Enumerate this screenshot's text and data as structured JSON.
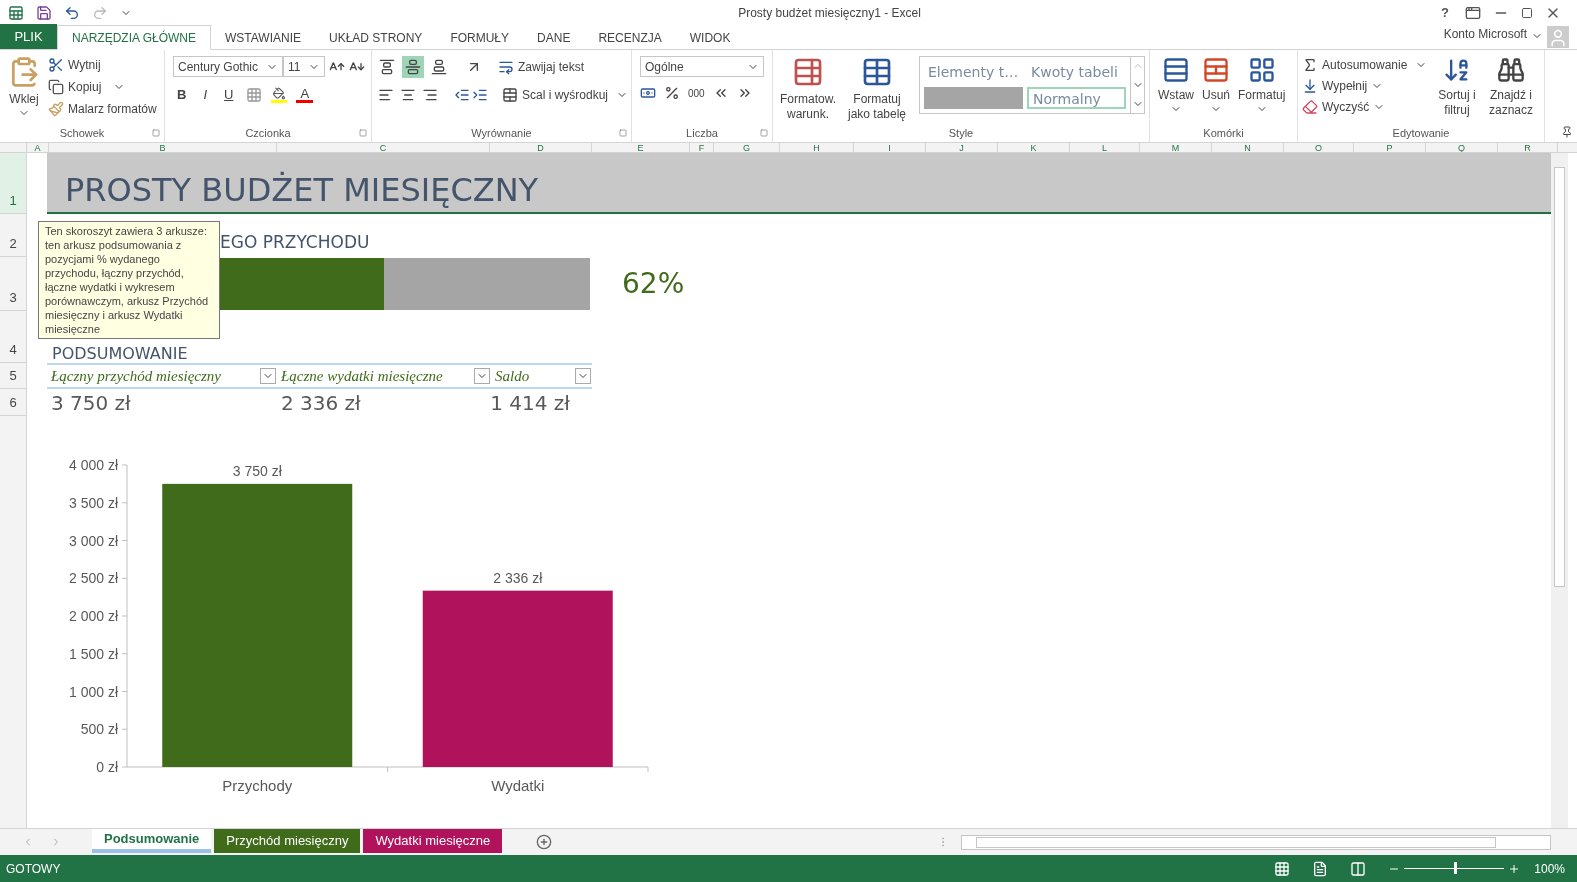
{
  "window": {
    "title": "Prosty budżet miesięczny1 - Excel",
    "account": "Konto Microsoft",
    "help": "?"
  },
  "ribbon_tabs": [
    {
      "label": "PLIK",
      "kind": "file",
      "selected": false
    },
    {
      "label": "NARZĘDZIA GŁÓWNE",
      "kind": "tab",
      "selected": true
    },
    {
      "label": "WSTAWIANIE",
      "kind": "tab",
      "selected": false
    },
    {
      "label": "UKŁAD STRONY",
      "kind": "tab",
      "selected": false
    },
    {
      "label": "FORMUŁY",
      "kind": "tab",
      "selected": false
    },
    {
      "label": "DANE",
      "kind": "tab",
      "selected": false
    },
    {
      "label": "RECENZJA",
      "kind": "tab",
      "selected": false
    },
    {
      "label": "WIDOK",
      "kind": "tab",
      "selected": false
    }
  ],
  "clipboard": {
    "paste": "Wklej",
    "cut": "Wytnij",
    "copy": "Kopiuj",
    "format_painter": "Malarz formatów",
    "label": "Schowek"
  },
  "font": {
    "family": "Century Gothic",
    "size": "11",
    "bold": "B",
    "italic": "I",
    "underline": "U",
    "font_color": "A",
    "label": "Czcionka"
  },
  "alignment": {
    "vertical": [
      {
        "selected": false
      },
      {
        "selected": true
      },
      {
        "selected": false
      }
    ],
    "wrap": "Zawijaj tekst",
    "merge": "Scal i wyśrodkuj",
    "label": "Wyrównanie"
  },
  "number": {
    "format": "Ogólne",
    "thousands": "000",
    "label": "Liczba"
  },
  "styles": {
    "conditional": "Formatow. warunk.",
    "as_table": "Formatuj jako tabelę",
    "gallery": [
      {
        "kind": "text",
        "label": "Elementy t…",
        "selected": false
      },
      {
        "kind": "text",
        "label": "Kwoty tabeli",
        "selected": false
      },
      {
        "kind": "swatch",
        "selected": false
      },
      {
        "kind": "text",
        "label": "Normalny",
        "selected": true
      }
    ],
    "label": "Style"
  },
  "cells": {
    "insert": "Wstaw",
    "delete": "Usuń",
    "format": "Formatuj",
    "label": "Komórki"
  },
  "editing": {
    "autosum": "Autosumowanie",
    "fill": "Wypełnij",
    "clear": "Wyczyść",
    "sort": "Sortuj i filtruj",
    "find": "Znajdź i zaznacz",
    "label": "Edytowanie"
  },
  "columns": [
    "A",
    "B",
    "C",
    "D",
    "E",
    "F",
    "G",
    "H",
    "I",
    "J",
    "K",
    "L",
    "M",
    "N",
    "O",
    "P",
    "Q",
    "R"
  ],
  "rows": [
    "1",
    "2",
    "3",
    "4",
    "5",
    "6"
  ],
  "sheet": {
    "title": "PROSTY BUDŻET MIESIĘCZNY",
    "progress_label": "EGO PRZYCHODU",
    "progress": {
      "level": 0.62,
      "reading": "62%"
    },
    "summary_heading": "PODSUMOWANIE",
    "table": {
      "columns": [
        "Łączny przychód miesięczny",
        "Łączne wydatki miesięczne",
        "Saldo"
      ],
      "values": [
        "3 750 zł",
        "2 336 zł",
        "1 414 zł"
      ]
    },
    "tooltip": "Ten skoroszyt zawiera 3 arkusze: ten arkusz podsumowania z pozycjami % wydanego przychodu, łączny przychód, łączne wydatki i wykresem porównawczym, arkusz Przychód miesięczny i arkusz Wydatki miesięczne",
    "chart_data": {
      "type": "bar",
      "series": [
        {
          "name": "Przychody",
          "color": "#3f6b1a",
          "values": [
            3750
          ]
        },
        {
          "name": "Wydatki",
          "color": "#b0125b",
          "values": [
            2336
          ]
        }
      ],
      "value_labels": [
        "3 750 zł",
        "2 336 zł"
      ],
      "ylim": [
        0,
        4000
      ],
      "yticks": [
        {
          "value": 0,
          "label": "0 zł"
        },
        {
          "value": 500,
          "label": "500 zł"
        },
        {
          "value": 1000,
          "label": "1 000 zł"
        },
        {
          "value": 1500,
          "label": "1 500 zł"
        },
        {
          "value": 2000,
          "label": "2 000 zł"
        },
        {
          "value": 2500,
          "label": "2 500 zł"
        },
        {
          "value": 3000,
          "label": "3 000 zł"
        },
        {
          "value": 3500,
          "label": "3 500 zł"
        },
        {
          "value": 4000,
          "label": "4 000 zł"
        }
      ]
    }
  },
  "sheet_tabs": [
    {
      "label": "Podsumowanie",
      "selected": true,
      "color": "#9bc2e6"
    },
    {
      "label": "Przychód miesięczny",
      "selected": false,
      "color": "#3f6b1a"
    },
    {
      "label": "Wydatki miesięczne",
      "selected": false,
      "color": "#b0125b"
    }
  ],
  "status_bar": {
    "status": "GOTOWY",
    "zoom": "100%",
    "zoom_slider": {
      "level": 0.5
    }
  }
}
